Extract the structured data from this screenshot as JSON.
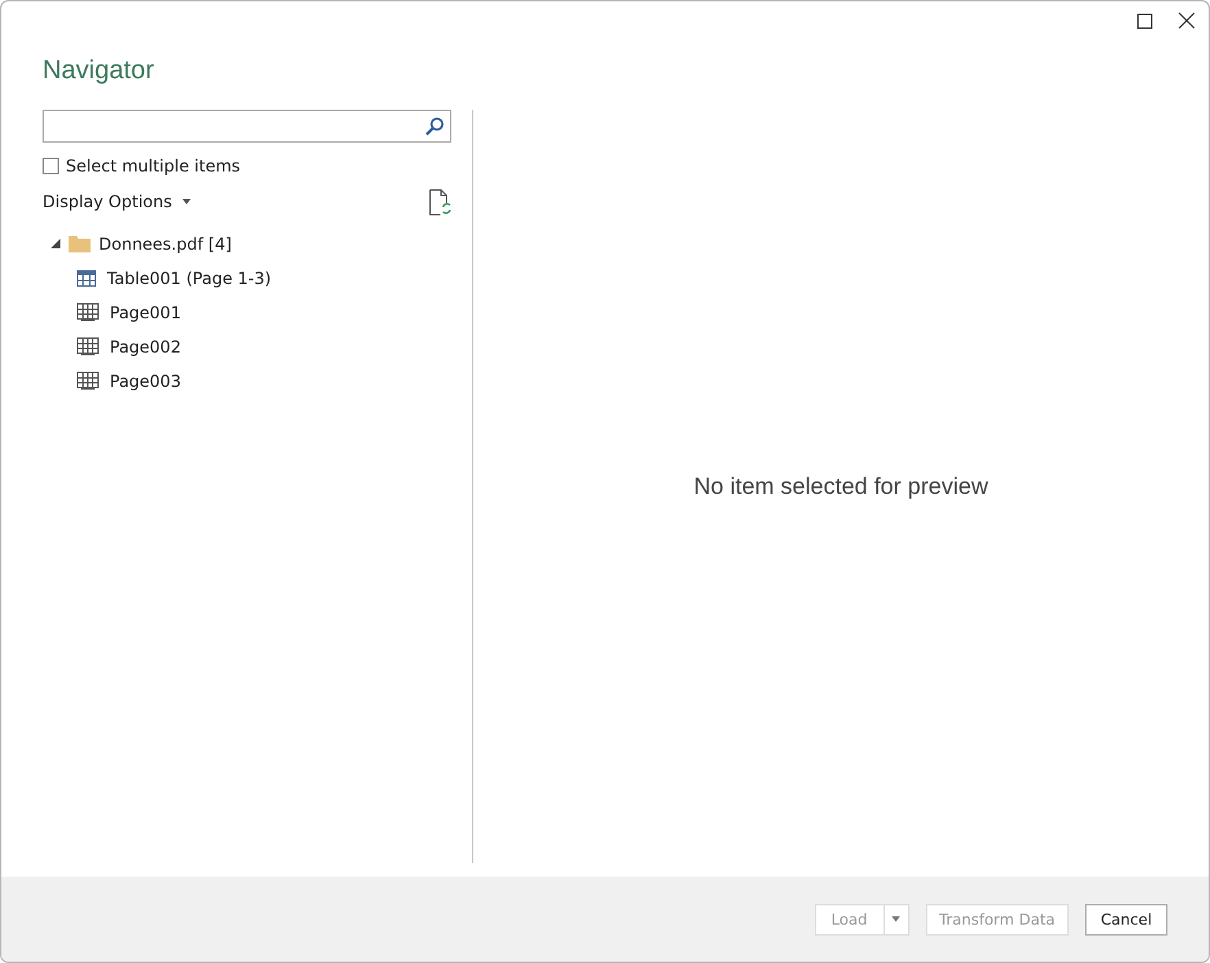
{
  "window": {
    "title": "Navigator"
  },
  "select_multiple": {
    "label": "Select multiple items",
    "checked": false
  },
  "display_options": {
    "label": "Display Options"
  },
  "tree": [
    {
      "kind": "folder",
      "label": "Donnees.pdf [4]",
      "expanded": true,
      "children": [
        {
          "kind": "table",
          "label": "Table001 (Page 1-3)"
        },
        {
          "kind": "page",
          "label": "Page001"
        },
        {
          "kind": "page",
          "label": "Page002"
        },
        {
          "kind": "page",
          "label": "Page003"
        }
      ]
    }
  ],
  "preview": {
    "message": "No item selected for preview"
  },
  "buttons": [
    {
      "kind": "split",
      "label": "Load",
      "disabled": true
    },
    {
      "kind": "plain",
      "label": "Transform Data",
      "disabled": true
    },
    {
      "kind": "plain",
      "label": "Cancel",
      "disabled": false
    }
  ]
}
